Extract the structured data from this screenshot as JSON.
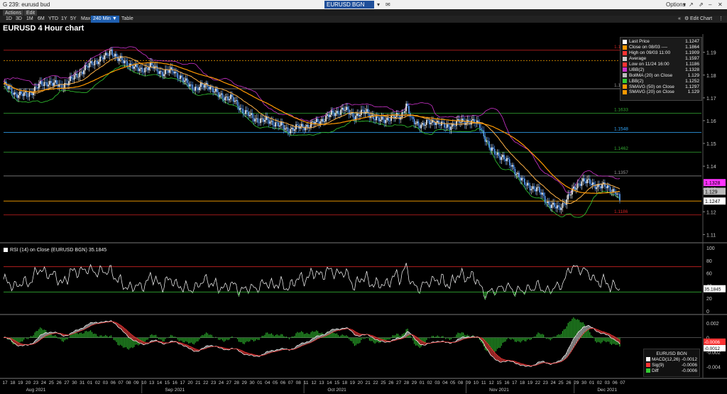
{
  "window": {
    "title": "G 239: eurusd bud",
    "ticker": "EURUSD BGN Curncy",
    "options_label": "Options"
  },
  "menubar": {
    "actions": "Actions",
    "edit": "Edit"
  },
  "rangebar": {
    "ranges": [
      "1D",
      "3D",
      "1M",
      "6M",
      "YTD",
      "1Y",
      "5Y",
      "Max"
    ],
    "active_interval": "240 Min ▼",
    "table_label": "Table",
    "edit_chart": "Edit Chart"
  },
  "chart_title": "EURUSD 4 Hour chart",
  "price_legend": [
    {
      "label": "Last Price",
      "value": "1.1247",
      "color": "#ffffff"
    },
    {
      "label": "Close on 08/03 ----",
      "value": "1.1864",
      "color": "#ff9900"
    },
    {
      "label": "High on 09/03 11:00",
      "value": "1.1909",
      "color": "#ff3333"
    },
    {
      "label": "Average",
      "value": "1.1597",
      "color": "#cccccc"
    },
    {
      "label": "Low on 11/24 16:00",
      "value": "1.1186",
      "color": "#ff3333"
    },
    {
      "label": "UBB(2)",
      "value": "1.1328",
      "color": "#cc33cc"
    },
    {
      "label": "BollMA (20)   on Close",
      "value": "1.129",
      "color": "#bbbbbb"
    },
    {
      "label": "LBB(2)",
      "value": "1.1252",
      "color": "#33cc33"
    },
    {
      "label": "SMAVG (50)   on Close",
      "value": "1.1297",
      "color": "#ff9900"
    },
    {
      "label": "SMAVG (20)   on Close",
      "value": "1.129",
      "color": "#ff9900"
    }
  ],
  "rsi_label": "RSI (14)   on Close (EURUSD BGN) 35.1845",
  "macd_legend": {
    "title": "EURUSD BGN",
    "rows": [
      {
        "label": "MACD(12,26)",
        "value": "-0.0012",
        "color": "#ffffff"
      },
      {
        "label": "Sig(9)",
        "value": "-0.0006",
        "color": "#ff3333"
      },
      {
        "label": "Diff",
        "value": "-0.0006",
        "color": "#33cc33"
      }
    ]
  },
  "colors": {
    "bg": "#000000",
    "candle_up": "#ffffff",
    "candle_down": "#5aa0ff",
    "ubb": "#cc33cc",
    "lbb": "#33cc33",
    "sma": "#ff9900",
    "rsi": "#ffffff",
    "macd_fill": "#aaaaaa",
    "macd_sig": "#ff3333",
    "diff": "#33cc33"
  },
  "chart_data": [
    {
      "type": "candlestick",
      "title": "EURUSD 4 Hour chart",
      "ylim": [
        1.107,
        1.198
      ],
      "yticks": [
        "1.19",
        "1.18",
        "1.17",
        "1.16",
        "1.15",
        "1.14",
        "1.13",
        "1.12",
        "1.11"
      ],
      "right_tags": [
        {
          "label": "1.1328",
          "value": 1.1328,
          "color": "#ff33ff",
          "text_color": "#000000"
        },
        {
          "label": "1.129",
          "value": 1.129,
          "color": "#bbbbbb",
          "text_color": "#000000"
        },
        {
          "label": "1.1247",
          "value": 1.1247,
          "color": "#ffffff",
          "text_color": "#000000"
        }
      ],
      "hlines": [
        {
          "value": 1.1909,
          "color": "#cc2222",
          "style": "solid",
          "label": "1.19"
        },
        {
          "value": 1.1864,
          "color": "#ffa500",
          "style": "dotted",
          "label": ""
        },
        {
          "value": 1.174,
          "color": "#999999",
          "style": "solid",
          "label": "1.17"
        },
        {
          "value": 1.1633,
          "color": "#33aa33",
          "style": "solid",
          "label": "1.1633"
        },
        {
          "value": 1.1548,
          "color": "#33aaff",
          "style": "solid",
          "label": "1.1548"
        },
        {
          "value": 1.1462,
          "color": "#33aa33",
          "style": "solid",
          "label": "1.1462"
        },
        {
          "value": 1.1357,
          "color": "#999999",
          "style": "solid",
          "label": "1.1357"
        },
        {
          "value": 1.1247,
          "color": "#ffa500",
          "style": "solid",
          "label": ""
        },
        {
          "value": 1.1186,
          "color": "#cc2222",
          "style": "solid",
          "label": "1.1186"
        }
      ],
      "close_path": [
        [
          0,
          1.176
        ],
        [
          8,
          1.172
        ],
        [
          17,
          1.171
        ],
        [
          25,
          1.175
        ],
        [
          33,
          1.177
        ],
        [
          42,
          1.175
        ],
        [
          50,
          1.178
        ],
        [
          58,
          1.182
        ],
        [
          67,
          1.186
        ],
        [
          75,
          1.188
        ],
        [
          79,
          1.191
        ],
        [
          84,
          1.187
        ],
        [
          92,
          1.185
        ],
        [
          100,
          1.182
        ],
        [
          108,
          1.184
        ],
        [
          117,
          1.181
        ],
        [
          125,
          1.182
        ],
        [
          133,
          1.177
        ],
        [
          142,
          1.174
        ],
        [
          150,
          1.176
        ],
        [
          158,
          1.171
        ],
        [
          167,
          1.17
        ],
        [
          175,
          1.165
        ],
        [
          183,
          1.161
        ],
        [
          192,
          1.16
        ],
        [
          200,
          1.159
        ],
        [
          208,
          1.156
        ],
        [
          217,
          1.157
        ],
        [
          225,
          1.158
        ],
        [
          233,
          1.16
        ],
        [
          242,
          1.163
        ],
        [
          250,
          1.165
        ],
        [
          258,
          1.162
        ],
        [
          267,
          1.164
        ],
        [
          275,
          1.16
        ],
        [
          283,
          1.161
        ],
        [
          292,
          1.162
        ],
        [
          296,
          1.167
        ],
        [
          300,
          1.16
        ],
        [
          308,
          1.158
        ],
        [
          317,
          1.16
        ],
        [
          325,
          1.157
        ],
        [
          333,
          1.159
        ],
        [
          342,
          1.16
        ],
        [
          350,
          1.158
        ],
        [
          358,
          1.147
        ],
        [
          367,
          1.144
        ],
        [
          375,
          1.139
        ],
        [
          383,
          1.132
        ],
        [
          392,
          1.13
        ],
        [
          400,
          1.124
        ],
        [
          408,
          1.121
        ],
        [
          417,
          1.128
        ],
        [
          425,
          1.134
        ],
        [
          433,
          1.132
        ],
        [
          442,
          1.131
        ],
        [
          450,
          1.129
        ],
        [
          453,
          1.1247
        ]
      ],
      "rsi": {
        "label": "RSI (14) on Close (EURUSD BGN)",
        "last": 35.1845,
        "ylim": [
          0,
          100
        ],
        "yticks": [
          "100",
          "80",
          "60",
          "40",
          "20",
          "0"
        ],
        "overbought": 70,
        "oversold": 30,
        "tag": "35.1845"
      },
      "macd": {
        "yticks": [
          "0.002",
          "0",
          "-0.002",
          "-0.004"
        ],
        "ylim": [
          -0.0055,
          0.003
        ],
        "tags": [
          {
            "label": "-0.0006",
            "value": -0.0006,
            "color": "#ff3333"
          },
          {
            "label": "-0.0012",
            "value": -0.0012,
            "color": "#ffffff"
          }
        ]
      },
      "x_days": [
        "17",
        "18",
        "19",
        "20",
        "23",
        "24",
        "25",
        "26",
        "27",
        "30",
        "31",
        "01",
        "02",
        "03",
        "06",
        "07",
        "08",
        "09",
        "10",
        "13",
        "14",
        "15",
        "16",
        "17",
        "20",
        "21",
        "22",
        "23",
        "24",
        "27",
        "28",
        "29",
        "30",
        "01",
        "04",
        "05",
        "06",
        "07",
        "08",
        "11",
        "12",
        "13",
        "14",
        "15",
        "18",
        "19",
        "20",
        "21",
        "22",
        "25",
        "26",
        "27",
        "28",
        "29",
        "01",
        "02",
        "03",
        "04",
        "05",
        "08",
        "09",
        "10",
        "11",
        "12",
        "15",
        "16",
        "17",
        "18",
        "19",
        "22",
        "23",
        "24",
        "25",
        "26",
        "29",
        "30",
        "01",
        "02",
        "03",
        "06",
        "07"
      ],
      "x_months": [
        {
          "label": "Aug 2021",
          "day_index": 4
        },
        {
          "label": "Sep 2021",
          "day_index": 22
        },
        {
          "label": "Oct 2021",
          "day_index": 43
        },
        {
          "label": "Nov 2021",
          "day_index": 64
        },
        {
          "label": "Dec 2021",
          "day_index": 78
        }
      ]
    }
  ]
}
